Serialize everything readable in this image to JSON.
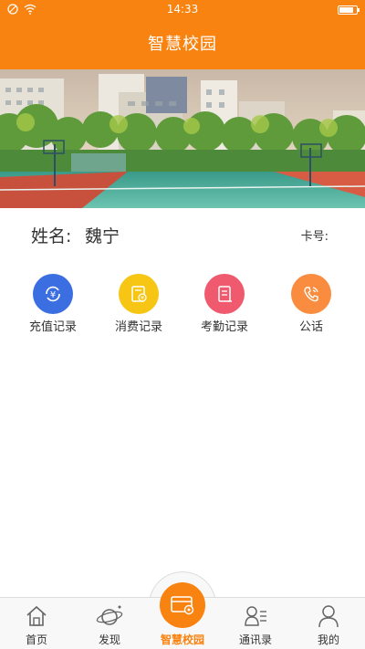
{
  "status_bar": {
    "time": "14:33",
    "battery_level": 0.85
  },
  "header": {
    "title": "智慧校园"
  },
  "user": {
    "name_label": "姓名:",
    "name": "魏宁",
    "card_label": "卡号:"
  },
  "actions": [
    {
      "label": "充值记录",
      "icon": "recharge-icon",
      "color": "#3b6ee0"
    },
    {
      "label": "消费记录",
      "icon": "consumption-icon",
      "color": "#f7c514"
    },
    {
      "label": "考勤记录",
      "icon": "attendance-icon",
      "color": "#f05a6e"
    },
    {
      "label": "公话",
      "icon": "phone-icon",
      "color": "#f98c3e"
    }
  ],
  "nav": {
    "items": [
      {
        "label": "首页",
        "icon": "home-icon"
      },
      {
        "label": "发现",
        "icon": "planet-icon"
      },
      {
        "label": "智慧校园",
        "icon": "card-gear-icon",
        "active": true
      },
      {
        "label": "通讯录",
        "icon": "contacts-icon"
      },
      {
        "label": "我的",
        "icon": "person-icon"
      }
    ]
  },
  "colors": {
    "accent": "#f98310"
  }
}
